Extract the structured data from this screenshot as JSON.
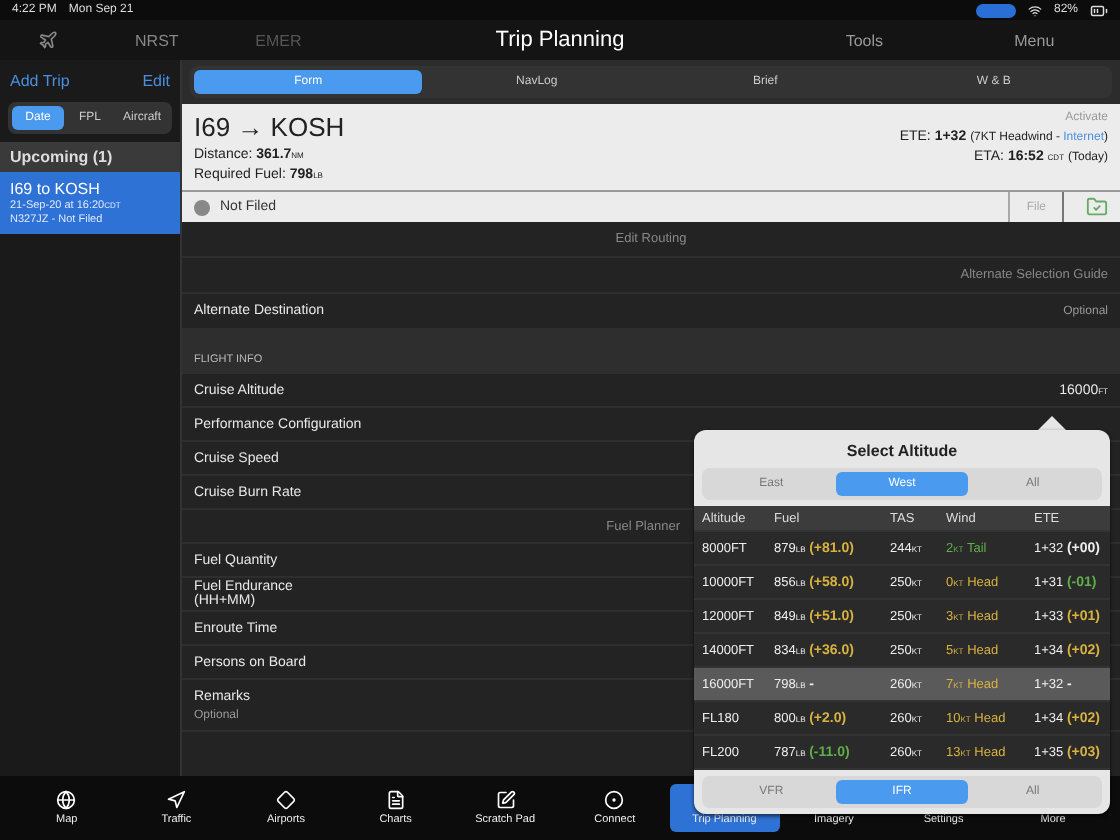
{
  "status_bar": {
    "time": "4:22 PM",
    "date": "Mon Sep 21",
    "battery": "82%"
  },
  "top_bar": {
    "left_tabs": [
      "NRST",
      "EMER"
    ],
    "title": "Trip Planning",
    "right_buttons": [
      "Tools",
      "Menu"
    ]
  },
  "sidebar": {
    "add": "Add Trip",
    "edit": "Edit",
    "sort_tabs": [
      {
        "label": "Date",
        "selected": true
      },
      {
        "label": "FPL",
        "selected": false
      },
      {
        "label": "Aircraft",
        "selected": false
      }
    ],
    "section": "Upcoming (1)",
    "trips": [
      {
        "title": "I69 to KOSH",
        "line_1": "21-Sep-20 at 16:20",
        "line_1_unit": "CDT",
        "line_2": "N327JZ - Not Filed",
        "selected": true
      }
    ]
  },
  "tabs": [
    {
      "label": "Form",
      "selected": true
    },
    {
      "label": "NavLog",
      "selected": false
    },
    {
      "label": "Brief",
      "selected": false
    },
    {
      "label": "W & B",
      "selected": false
    }
  ],
  "trip": {
    "route": "I69 → KOSH",
    "distance_label": "Distance:",
    "distance": "361.7",
    "distance_unit": "NM",
    "fuel_label": "Required Fuel:",
    "fuel": "798",
    "fuel_unit": "LB",
    "activate": "Activate",
    "ete_label": "ETE:",
    "ete": "1+32",
    "ete_note": "(7KT Headwind - ",
    "ete_link": "Internet",
    "ete_note_end": ")",
    "eta_label": "ETA:",
    "eta": "16:52",
    "eta_unit": "CDT",
    "eta_note": "(Today)",
    "filing_status": "Not Filed",
    "file_button": "File"
  },
  "links": [
    "Edit Routing",
    "Alternate Selection Guide"
  ],
  "alternate": {
    "label": "Alternate Destination",
    "placeholder": "Optional"
  },
  "flight_info": {
    "header": "FLIGHT INFO",
    "rows": [
      {
        "kind": "value",
        "label": "Cruise Altitude",
        "value": "16000",
        "unit": "FT"
      },
      {
        "kind": "label",
        "label": "Performance Configuration"
      },
      {
        "kind": "label",
        "label": "Cruise Speed"
      },
      {
        "kind": "label",
        "label": "Cruise Burn Rate"
      },
      {
        "kind": "link",
        "label": "Fuel Planner"
      },
      {
        "kind": "label",
        "label": "Fuel Quantity"
      },
      {
        "kind": "wrapped",
        "label": "Fuel Endurance (HH+MM)"
      },
      {
        "kind": "label",
        "label": "Enroute Time"
      },
      {
        "kind": "label",
        "label": "Persons on Board"
      },
      {
        "kind": "remarks",
        "label": "Remarks",
        "placeholder": "Optional"
      }
    ]
  },
  "popover": {
    "title": "Select Altitude",
    "direction_tabs": [
      {
        "label": "East",
        "selected": false
      },
      {
        "label": "West",
        "selected": true
      },
      {
        "label": "All",
        "selected": false
      }
    ],
    "columns": [
      "Altitude",
      "Fuel",
      "TAS",
      "Wind",
      "ETE"
    ],
    "rows": [
      {
        "altitude": "8000FT",
        "fuel": "879",
        "fuel_unit": "LB",
        "fuel_delta": {
          "text": "(+81.0)",
          "color": "#d8b23e"
        },
        "tas": "244",
        "tas_unit": "KT",
        "wind": {
          "speed": "2",
          "unit": "KT",
          "text": "Tail",
          "color": "#5fae4a"
        },
        "ete": "1+32",
        "ete_delta": {
          "text": "(+00)",
          "color": "#eeeeee"
        },
        "selected": false
      },
      {
        "altitude": "10000FT",
        "fuel": "856",
        "fuel_unit": "LB",
        "fuel_delta": {
          "text": "(+58.0)",
          "color": "#d8b23e"
        },
        "tas": "250",
        "tas_unit": "KT",
        "wind": {
          "speed": "0",
          "unit": "KT",
          "text": "Head",
          "color": "#d8b23e"
        },
        "ete": "1+31",
        "ete_delta": {
          "text": "(-01)",
          "color": "#5fae4a"
        },
        "selected": false
      },
      {
        "altitude": "12000FT",
        "fuel": "849",
        "fuel_unit": "LB",
        "fuel_delta": {
          "text": "(+51.0)",
          "color": "#d8b23e"
        },
        "tas": "250",
        "tas_unit": "KT",
        "wind": {
          "speed": "3",
          "unit": "KT",
          "text": "Head",
          "color": "#d8b23e"
        },
        "ete": "1+33",
        "ete_delta": {
          "text": "(+01)",
          "color": "#d8b23e"
        },
        "selected": false
      },
      {
        "altitude": "14000FT",
        "fuel": "834",
        "fuel_unit": "LB",
        "fuel_delta": {
          "text": "(+36.0)",
          "color": "#d8b23e"
        },
        "tas": "250",
        "tas_unit": "KT",
        "wind": {
          "speed": "5",
          "unit": "KT",
          "text": "Head",
          "color": "#d8b23e"
        },
        "ete": "1+34",
        "ete_delta": {
          "text": "(+02)",
          "color": "#d8b23e"
        },
        "selected": false
      },
      {
        "altitude": "16000FT",
        "fuel": "798",
        "fuel_unit": "LB",
        "fuel_delta": {
          "text": "-",
          "color": "#eeeeee"
        },
        "tas": "260",
        "tas_unit": "KT",
        "wind": {
          "speed": "7",
          "unit": "KT",
          "text": "Head",
          "color": "#d8b23e"
        },
        "ete": "1+32",
        "ete_delta": {
          "text": "-",
          "color": "#eeeeee"
        },
        "selected": true
      },
      {
        "altitude": "FL180",
        "fuel": "800",
        "fuel_unit": "LB",
        "fuel_delta": {
          "text": "(+2.0)",
          "color": "#d8b23e"
        },
        "tas": "260",
        "tas_unit": "KT",
        "wind": {
          "speed": "10",
          "unit": "KT",
          "text": "Head",
          "color": "#d8b23e"
        },
        "ete": "1+34",
        "ete_delta": {
          "text": "(+02)",
          "color": "#d8b23e"
        },
        "selected": false
      },
      {
        "altitude": "FL200",
        "fuel": "787",
        "fuel_unit": "LB",
        "fuel_delta": {
          "text": "(-11.0)",
          "color": "#5fae4a"
        },
        "tas": "260",
        "tas_unit": "KT",
        "wind": {
          "speed": "13",
          "unit": "KT",
          "text": "Head",
          "color": "#d8b23e"
        },
        "ete": "1+35",
        "ete_delta": {
          "text": "(+03)",
          "color": "#d8b23e"
        },
        "selected": false
      }
    ],
    "rule_tabs": [
      {
        "label": "VFR",
        "selected": false
      },
      {
        "label": "IFR",
        "selected": true
      },
      {
        "label": "All",
        "selected": false
      }
    ]
  },
  "bottom_tabs": [
    {
      "kind": "map",
      "label": "Map",
      "selected": false
    },
    {
      "kind": "traffic",
      "label": "Traffic",
      "selected": false
    },
    {
      "kind": "airports",
      "label": "Airports",
      "selected": false
    },
    {
      "kind": "charts",
      "label": "Charts",
      "selected": false
    },
    {
      "kind": "scratch",
      "label": "Scratch Pad",
      "selected": false
    },
    {
      "kind": "connect",
      "label": "Connect",
      "selected": false
    },
    {
      "kind": "trip",
      "label": "Trip Planning",
      "selected": true
    },
    {
      "kind": "imagery",
      "label": "Imagery",
      "selected": false
    },
    {
      "kind": "settings",
      "label": "Settings",
      "selected": false
    },
    {
      "kind": "more",
      "label": "More",
      "selected": false
    }
  ]
}
